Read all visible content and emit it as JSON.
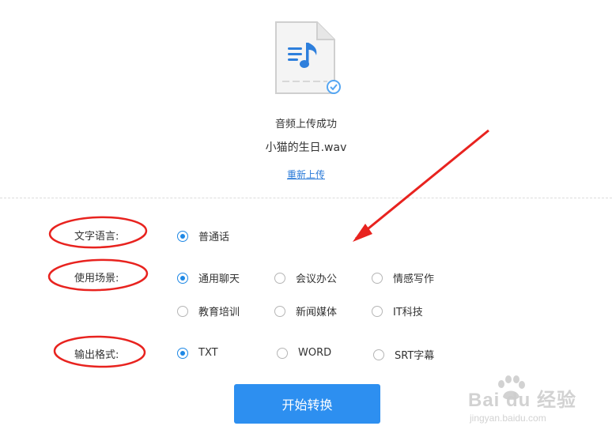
{
  "upload": {
    "status": "音频上传成功",
    "file_name": "小猫的生日.wav",
    "reupload_link": "重新上传"
  },
  "options": {
    "language": {
      "label": "文字语言:",
      "choices": [
        "普通话"
      ],
      "selected": "普通话"
    },
    "scene": {
      "label": "使用场景:",
      "choices": [
        "通用聊天",
        "会议办公",
        "情感写作",
        "教育培训",
        "新闻媒体",
        "IT科技"
      ],
      "selected": "通用聊天"
    },
    "format": {
      "label": "输出格式:",
      "choices": [
        "TXT",
        "WORD",
        "SRT字幕"
      ],
      "selected": "TXT"
    }
  },
  "start_button": "开始转换",
  "watermark": {
    "brand": "Bai du 经验",
    "url": "jingyan.baidu.com"
  },
  "colors": {
    "accent": "#2d8ff0",
    "annotation_red": "#e8231f",
    "link": "#2a7ad8"
  },
  "icons": {
    "file": "audio-file-icon",
    "check": "check-circle-icon",
    "arrow": "red-arrow-annotation"
  }
}
